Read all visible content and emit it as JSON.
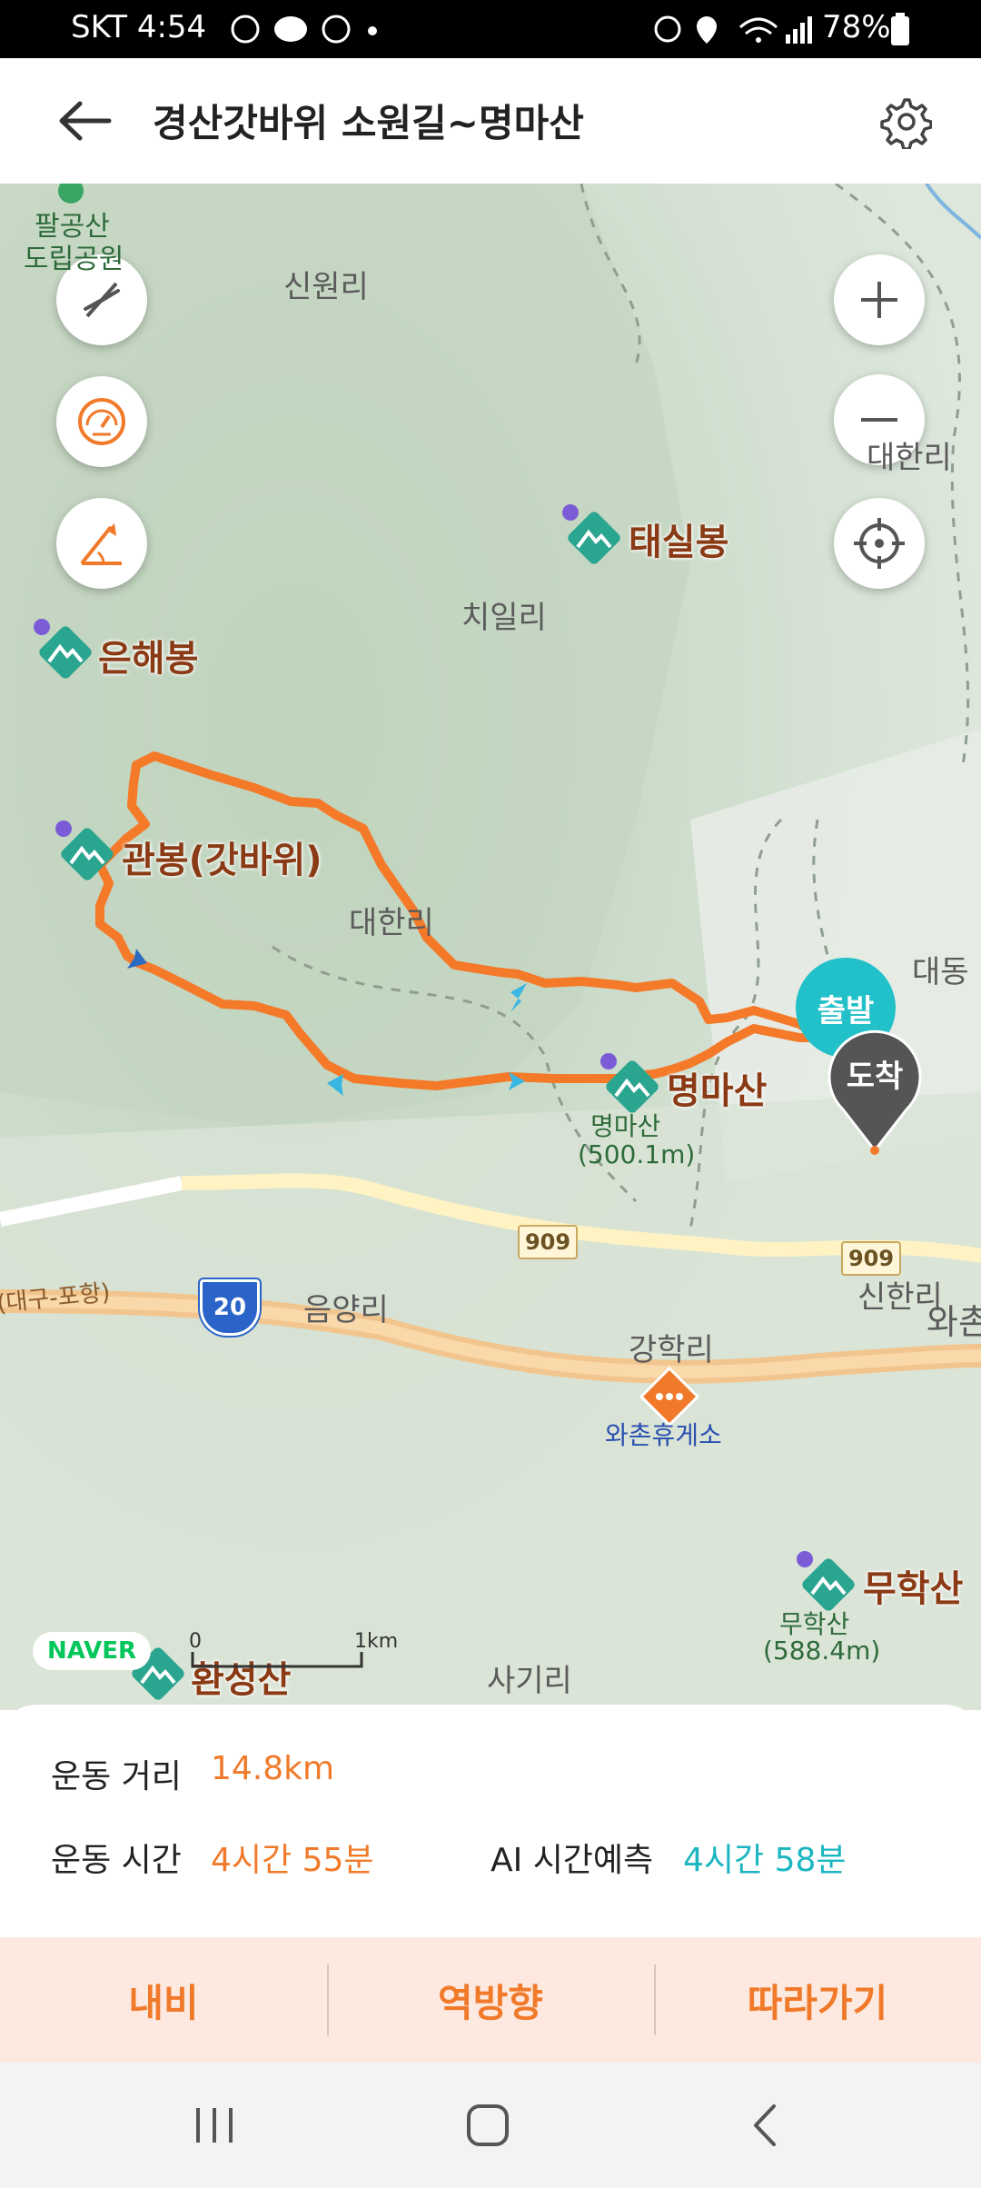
{
  "status": {
    "carrier_time": "SKT 4:54",
    "battery": "78%"
  },
  "header": {
    "title": "경산갓바위 소원길~명마산"
  },
  "map": {
    "places": {
      "palgong": "팔공산",
      "palgong2": "도립공원",
      "sinwon": "신원리",
      "chiil": "치일리",
      "daehan": "대한리",
      "daedong": "대동",
      "eumyang": "음양리",
      "ganghak": "강학리",
      "sinhan": "신한리",
      "wachon": "와촌",
      "sagi": "사기리",
      "hanseongsan_top": "환성산",
      "daegu_pohang": "(대구-포항)",
      "right_ri": "대한리"
    },
    "peaks": {
      "taesil": "태실봉",
      "eunhae": "은해봉",
      "gwanbong": "관봉(갓바위)",
      "myeongma": "명마산",
      "myeongma_sub": "명마산",
      "myeongma_elev": "(500.1m)",
      "muhak": "무학산",
      "muhak_sub": "무학산",
      "muhak_elev": "(588.4m)",
      "hwanseong": "환성산"
    },
    "rest_area": "와촌휴게소",
    "road_909a": "909",
    "road_909b": "909",
    "highway_20": "20",
    "start": "출발",
    "end": "도착",
    "naver": "NAVER",
    "scale_zero": "0",
    "scale_km": "1km"
  },
  "info": {
    "distance_label": "운동 거리",
    "distance_value": "14.8km",
    "time_label": "운동 시간",
    "time_value": "4시간 55분",
    "ai_label": "AI 시간예측",
    "ai_value": "4시간 58분"
  },
  "actions": {
    "navi": "내비",
    "reverse": "역방향",
    "follow": "따라가기"
  },
  "colors": {
    "route": "#f47a2a",
    "accent": "#f07a2a",
    "teal": "#1bb6c0",
    "peak_marker": "#2aa58f"
  }
}
